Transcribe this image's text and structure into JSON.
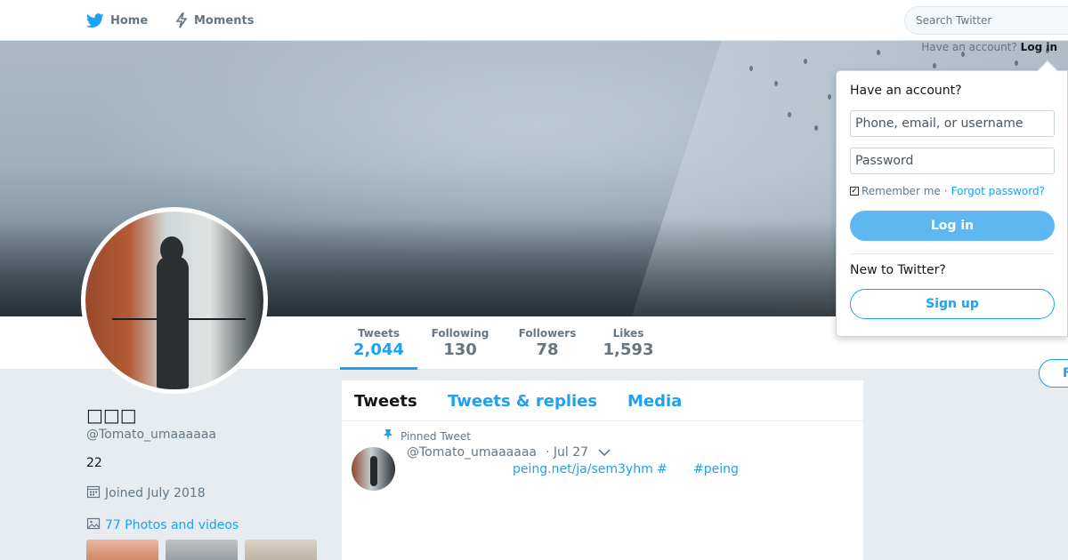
{
  "nav": {
    "home_label": "Home",
    "moments_label": "Moments",
    "search_placeholder": "Search Twitter"
  },
  "header": {
    "have_account_text": "Have an account?",
    "login_link": "Log in"
  },
  "profile": {
    "display_name": "□□□",
    "handle": "@Tomato_umaaaaaa",
    "bio": "22",
    "joined": "Joined July 2018",
    "photos_videos": "77 Photos and videos",
    "follow_label": "F"
  },
  "stats": [
    {
      "label": "Tweets",
      "value": "2,044"
    },
    {
      "label": "Following",
      "value": "130"
    },
    {
      "label": "Followers",
      "value": "78"
    },
    {
      "label": "Likes",
      "value": "1,593"
    }
  ],
  "timeline": {
    "tabs": [
      "Tweets",
      "Tweets & replies",
      "Media"
    ],
    "pinned_label": "Pinned Tweet",
    "tweet": {
      "handle": "@Tomato_umaaaaaa",
      "date": "· Jul 27",
      "link": "peing.net/ja/sem3yhm #",
      "hashtag": "#peing"
    }
  },
  "login_panel": {
    "question": "Have an account?",
    "username_placeholder": "Phone, email, or username",
    "password_placeholder": "Password",
    "remember_me": "Remember me",
    "separator": "·",
    "forgot_password": "Forgot password?",
    "login_button": "Log in",
    "new_to_twitter": "New to Twitter?",
    "signup_button": "Sign up"
  },
  "colors": {
    "accent": "#1da1f2",
    "background": "#e6ecf0"
  }
}
